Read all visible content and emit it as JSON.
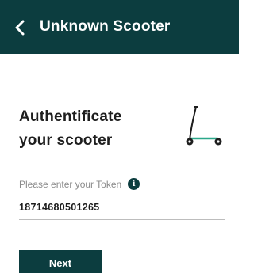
{
  "header": {
    "title": "Unknown Scooter",
    "back_icon": "chevron-left-icon"
  },
  "heading": {
    "line1": "Authentificate",
    "line2": "your scooter"
  },
  "illustration": {
    "icon": "scooter-icon"
  },
  "token": {
    "label": "Please enter your Token",
    "info_glyph": "i",
    "value": "18714680501265"
  },
  "actions": {
    "next_label": "Next"
  },
  "colors": {
    "primary": "#0c3d3f",
    "background": "#ffffff",
    "text": "#1e1e1e",
    "muted": "#8a8a8a",
    "accent": "#2ba88a"
  }
}
